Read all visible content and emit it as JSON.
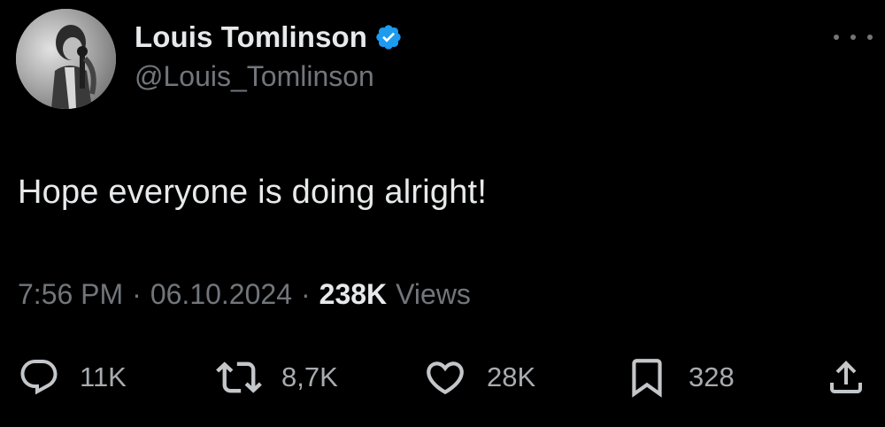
{
  "author": {
    "display_name": "Louis Tomlinson",
    "handle": "@Louis_Tomlinson",
    "verified": true
  },
  "tweet": {
    "text": "Hope everyone is doing alright!",
    "time": "7:56 PM",
    "date": "06.10.2024",
    "separator": "·",
    "views_count": "238K",
    "views_label": "Views"
  },
  "actions": {
    "replies": "11K",
    "reposts": "8,7K",
    "likes": "28K",
    "bookmarks": "328"
  },
  "colors": {
    "background": "#000000",
    "primary_text": "#e7e9ea",
    "secondary_text": "#71767b",
    "verified": "#1d9bf0"
  },
  "icons": {
    "more": "more-icon",
    "verified": "verified-badge-icon",
    "reply": "reply-icon",
    "repost": "repost-icon",
    "like": "heart-icon",
    "bookmark": "bookmark-icon",
    "share": "share-icon"
  }
}
